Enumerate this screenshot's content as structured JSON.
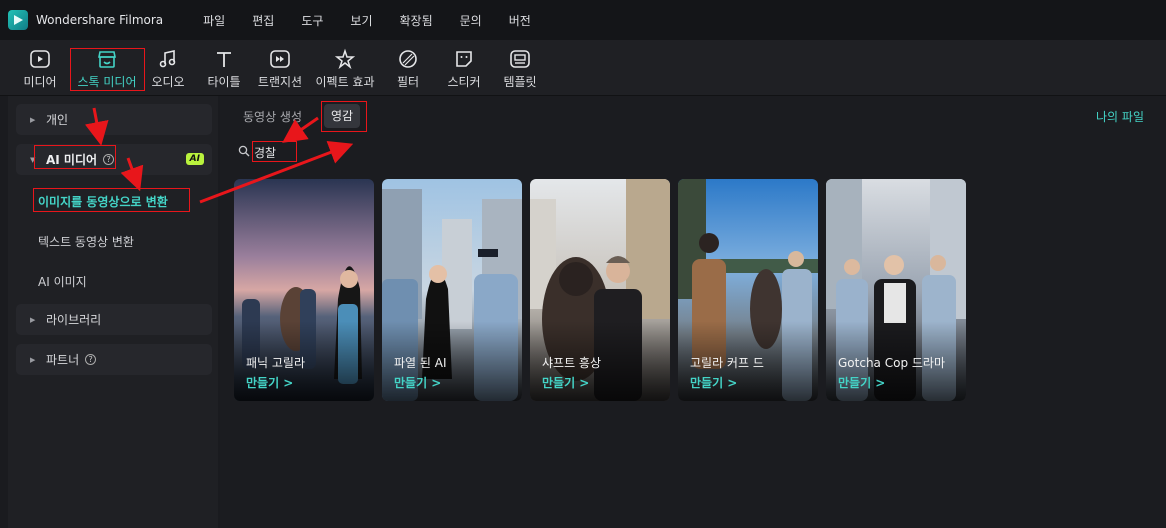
{
  "app": {
    "title": "Wondershare Filmora"
  },
  "menu": [
    "파일",
    "편집",
    "도구",
    "보기",
    "확장됨",
    "문의",
    "버전"
  ],
  "toolbar": [
    {
      "label": "미디어",
      "icon": "media-icon"
    },
    {
      "label": "스톡 미디어",
      "icon": "stock-media-icon"
    },
    {
      "label": "오디오",
      "icon": "audio-icon"
    },
    {
      "label": "타이틀",
      "icon": "title-icon"
    },
    {
      "label": "트랜지션",
      "icon": "transition-icon"
    },
    {
      "label": "이펙트 효과",
      "icon": "effect-icon"
    },
    {
      "label": "필터",
      "icon": "filter-icon"
    },
    {
      "label": "스티커",
      "icon": "sticker-icon"
    },
    {
      "label": "템플릿",
      "icon": "template-icon"
    }
  ],
  "toolbar_active": "스톡 미디어",
  "sidebar": {
    "personal": "개인",
    "ai_media": "AI 미디어",
    "ai_badge": "AI",
    "ai_items": [
      "이미지를 동영상으로 변환",
      "텍스트 동영상 변환",
      "AI 이미지"
    ],
    "library": "라이브러리",
    "partner": "파트너"
  },
  "main": {
    "tab_generate": "동영상 생성",
    "tab_inspire": "영감",
    "my_files": "나의 파일",
    "search_value": "경찰"
  },
  "cards": [
    {
      "title": "패닉 고릴라",
      "action": "만들기 >"
    },
    {
      "title": "파열 된 AI",
      "action": "만들기 >"
    },
    {
      "title": "샤프트 흥상",
      "action": "만들기 >"
    },
    {
      "title": "고릴라 커프 드",
      "action": "만들기 >"
    },
    {
      "title": "Gotcha Cop 드라마",
      "action": "만들기 >"
    }
  ],
  "colors": {
    "accent": "#44d4c7",
    "annotation": "#e8161b",
    "ai_badge": "#b9f23d"
  }
}
